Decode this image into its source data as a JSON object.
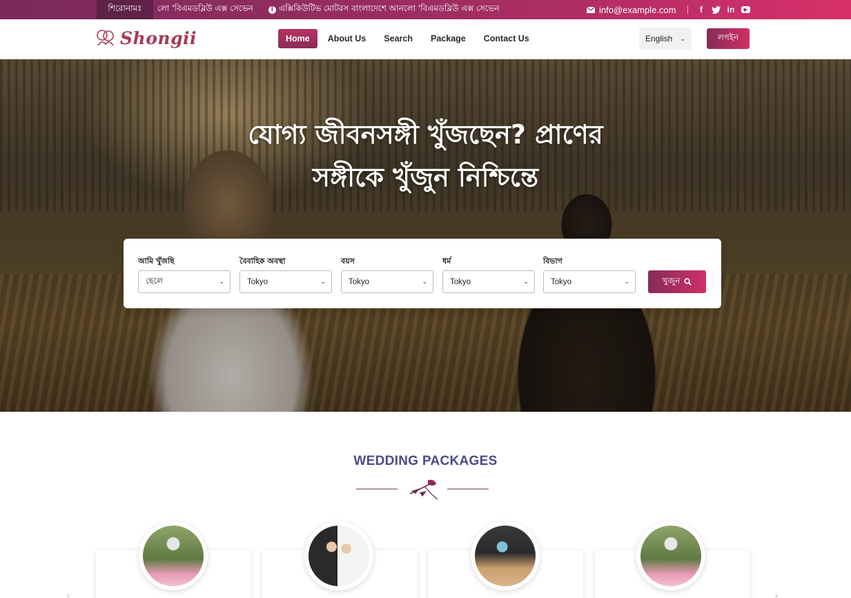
{
  "topbar": {
    "headline_label": "শিরোনামঃ",
    "ticker": [
      "লো 'বিএমডব্লিউ এক্স সেভেন",
      "এক্সিকিউটিভ মোটরস বাংলাদেশে আনলো 'বিএমডব্লিউ এক্স সেভেন"
    ],
    "email": "info@example.com",
    "socials": [
      "facebook",
      "twitter",
      "linkedin",
      "youtube"
    ]
  },
  "navbar": {
    "logo_text": "Shongii",
    "links": [
      "Home",
      "About Us",
      "Search",
      "Package",
      "Contact Us"
    ],
    "active": "Home",
    "language": "English",
    "login_label": "লগইন"
  },
  "hero": {
    "title_line1": "যোগ্য জীবনসঙ্গী খুঁজছেন? প্রাণের",
    "title_line2": "সঙ্গীকে খুঁজুন নিশ্চিন্তে"
  },
  "search": {
    "fields": [
      {
        "label": "আমি খুঁজছি",
        "value": "ছেলে"
      },
      {
        "label": "বৈবাহিক অবস্থা",
        "value": "Tokyo"
      },
      {
        "label": "বয়স",
        "value": "Tokyo"
      },
      {
        "label": "ধর্ম",
        "value": "Tokyo"
      },
      {
        "label": "বিভাগ",
        "value": "Tokyo"
      }
    ],
    "button_label": "খুজুন"
  },
  "packages": {
    "title": "WEDDING PACKAGES"
  },
  "icons": {
    "accent": "#a02d62",
    "brand": "#a83a56",
    "title_color": "#4a4a8c"
  }
}
